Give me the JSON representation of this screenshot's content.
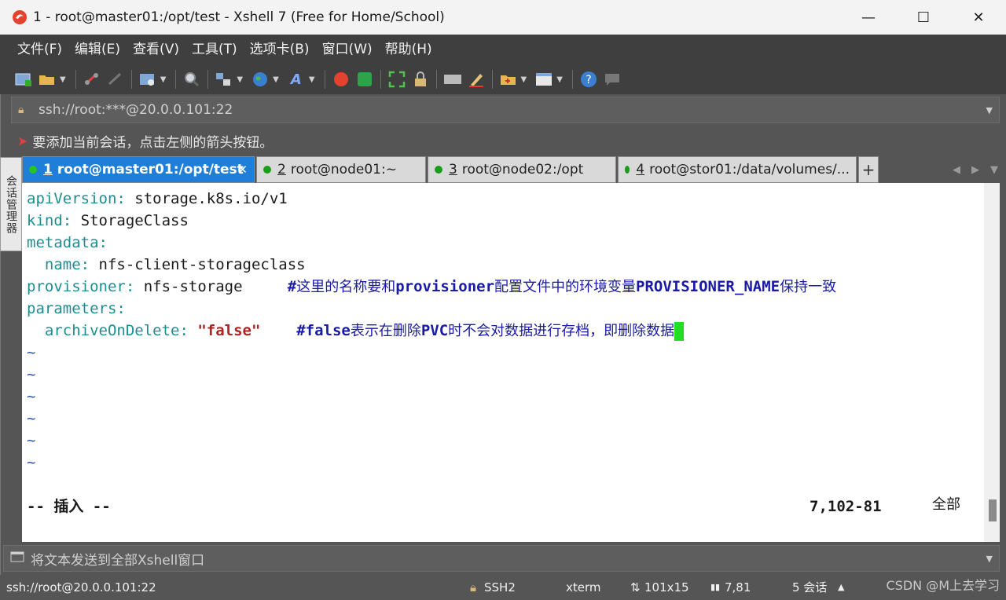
{
  "window": {
    "title": "1 - root@master01:/opt/test - Xshell 7 (Free for Home/School)",
    "minimize": "—",
    "maximize": "☐",
    "close": "✕"
  },
  "menu": [
    "文件(F)",
    "编辑(E)",
    "查看(V)",
    "工具(T)",
    "选项卡(B)",
    "窗口(W)",
    "帮助(H)"
  ],
  "address": {
    "value": "ssh://root:***@20.0.0.101:22"
  },
  "hint": "要添加当前会话，点击左侧的箭头按钮。",
  "session_manager_label": "会话管理器",
  "tabs": [
    {
      "num": "1",
      "label": "root@master01:/opt/test",
      "active": true
    },
    {
      "num": "2",
      "label": "root@node01:~",
      "active": false
    },
    {
      "num": "3",
      "label": "root@node02:/opt",
      "active": false
    },
    {
      "num": "4",
      "label": "root@stor01:/data/volumes/...",
      "active": false
    }
  ],
  "terminal": {
    "l1k": "apiVersion:",
    "l1v": " storage.k8s.io/v1",
    "l2k": "kind:",
    "l2v": " StorageClass",
    "l3k": "metadata:",
    "l4k": "  name:",
    "l4v": " nfs-client-storageclass",
    "l5k": "provisioner:",
    "l5v": " nfs-storage     ",
    "l5c1": "#",
    "l5c2": "这里的名称要和",
    "l5c3": "provisioner",
    "l5c4": "配置文件中的环境变量",
    "l5c5": "PROVISIONER_NAME",
    "l5c6": "保持一致",
    "l6k": "parameters:",
    "l7k": "  archiveOnDelete:",
    "l7s": " \"false\"",
    "l7sp": "    ",
    "l7c1": "#false",
    "l7c2": "表示在删除",
    "l7c3": "PVC",
    "l7c4": "时不会对数据进行存档，即删除数据",
    "tilde": "~",
    "mode": "-- 插入 --",
    "position": "7,102-81",
    "scroll": "全部"
  },
  "compose": "将文本发送到全部Xshell窗口",
  "status": {
    "connection": "ssh://root@20.0.0.101:22",
    "protocol": "SSH2",
    "term": "xterm",
    "size": "101x15",
    "cursor": "7,81",
    "sessions": "5 会话",
    "watermark": "CSDN @M上去学习"
  }
}
